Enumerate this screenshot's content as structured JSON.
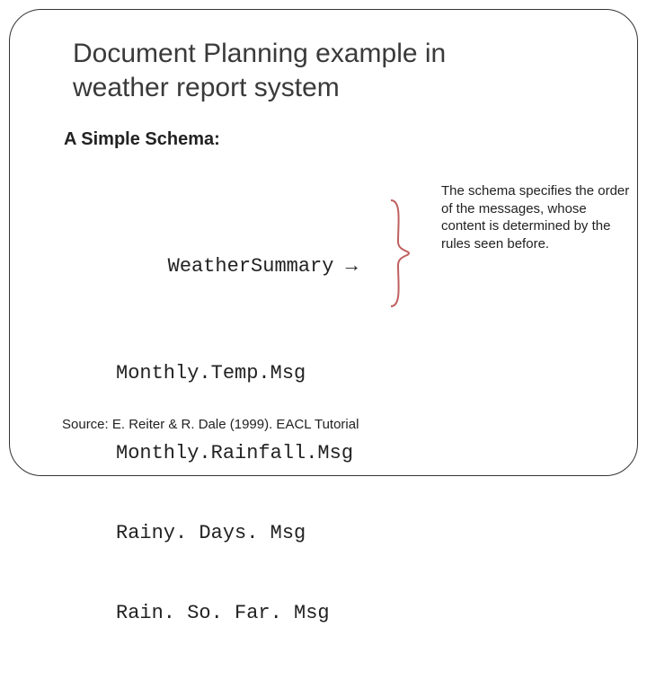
{
  "title": "Document Planning example in weather report system",
  "subhead": "A Simple Schema:",
  "schema": {
    "head_name": "WeatherSummary",
    "arrow": "→",
    "items": [
      "Monthly.Temp.Msg",
      "Monthly.Rainfall.Msg",
      "Rainy. Days. Msg",
      "Rain. So. Far. Msg"
    ]
  },
  "note": "The schema specifies the order of the messages, whose content is determined by the rules seen before.",
  "source": "Source: E. Reiter & R. Dale (1999). EACL Tutorial"
}
